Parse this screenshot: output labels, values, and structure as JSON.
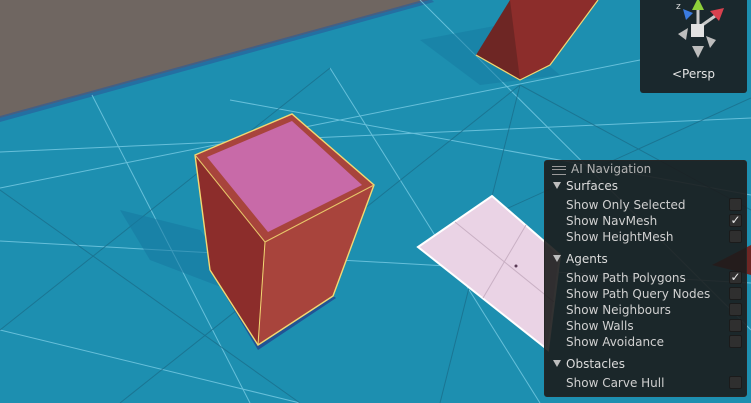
{
  "gizmo": {
    "projection_label": "Persp",
    "axis_label": "z"
  },
  "ai_navigation": {
    "title": "AI Navigation",
    "sections": [
      {
        "label": "Surfaces",
        "items": [
          {
            "label": "Show Only Selected",
            "checked": false
          },
          {
            "label": "Show NavMesh",
            "checked": true
          },
          {
            "label": "Show HeightMesh",
            "checked": false
          }
        ]
      },
      {
        "label": "Agents",
        "items": [
          {
            "label": "Show Path Polygons",
            "checked": true
          },
          {
            "label": "Show Path Query Nodes",
            "checked": false
          },
          {
            "label": "Show Neighbours",
            "checked": false
          },
          {
            "label": "Show Walls",
            "checked": false
          },
          {
            "label": "Show Avoidance",
            "checked": false
          }
        ]
      },
      {
        "label": "Obstacles",
        "items": [
          {
            "label": "Show Carve Hull",
            "checked": false
          }
        ]
      }
    ]
  },
  "colors": {
    "navmesh": "#1d8fb0",
    "ground": "#6f6661",
    "obstacle_side_dark": "#8c2d2b",
    "obstacle_side_light": "#a8443c",
    "obstacle_top": "#c86aa8",
    "selected_outline": "#f2d872",
    "panel_bg": "#1c1c1c"
  }
}
